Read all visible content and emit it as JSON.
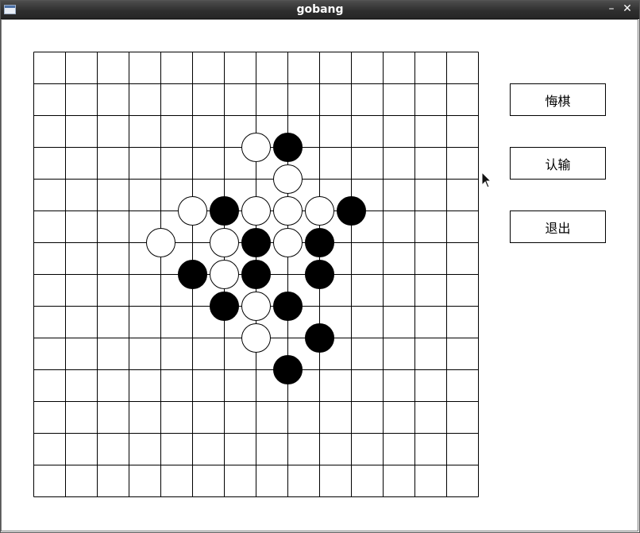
{
  "window": {
    "title": "gobang",
    "minimize_glyph": "–",
    "close_glyph": "✕"
  },
  "board": {
    "rows": 14,
    "cols": 14,
    "line_color": "#000000",
    "black_color": "#000000",
    "white_color": "#ffffff",
    "stones": [
      {
        "color": "white",
        "col": 7,
        "row": 3
      },
      {
        "color": "black",
        "col": 8,
        "row": 3
      },
      {
        "color": "white",
        "col": 8,
        "row": 4
      },
      {
        "color": "white",
        "col": 5,
        "row": 5
      },
      {
        "color": "black",
        "col": 6,
        "row": 5
      },
      {
        "color": "white",
        "col": 7,
        "row": 5
      },
      {
        "color": "white",
        "col": 8,
        "row": 5
      },
      {
        "color": "white",
        "col": 9,
        "row": 5
      },
      {
        "color": "black",
        "col": 10,
        "row": 5
      },
      {
        "color": "white",
        "col": 4,
        "row": 6
      },
      {
        "color": "white",
        "col": 6,
        "row": 6
      },
      {
        "color": "black",
        "col": 7,
        "row": 6
      },
      {
        "color": "white",
        "col": 8,
        "row": 6
      },
      {
        "color": "black",
        "col": 9,
        "row": 6
      },
      {
        "color": "black",
        "col": 5,
        "row": 7
      },
      {
        "color": "white",
        "col": 6,
        "row": 7
      },
      {
        "color": "black",
        "col": 7,
        "row": 7
      },
      {
        "color": "black",
        "col": 9,
        "row": 7
      },
      {
        "color": "black",
        "col": 6,
        "row": 8
      },
      {
        "color": "white",
        "col": 7,
        "row": 8
      },
      {
        "color": "black",
        "col": 8,
        "row": 8
      },
      {
        "color": "white",
        "col": 7,
        "row": 9
      },
      {
        "color": "black",
        "col": 9,
        "row": 9
      },
      {
        "color": "black",
        "col": 8,
        "row": 10
      }
    ]
  },
  "controls": {
    "undo_label": "悔棋",
    "resign_label": "认输",
    "quit_label": "退出"
  }
}
